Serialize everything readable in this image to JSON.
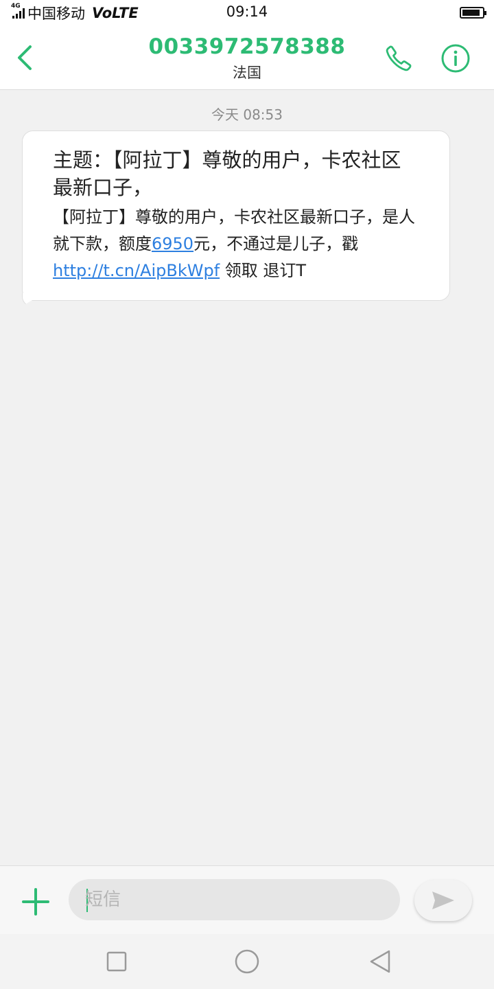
{
  "status_bar": {
    "network_type": "4G",
    "carrier": "中国移动",
    "volte": "VoLTE",
    "time": "09:14",
    "battery_level": 0.88
  },
  "header": {
    "contact_number": "0033972578388",
    "contact_location": "法国"
  },
  "conversation": {
    "timestamp": "今天 08:53",
    "message": {
      "subject": "主题：【阿拉丁】尊敬的用户，卡农社区最新口子，",
      "body_part1": "【阿拉丁】尊敬的用户，卡农社区最新口子，是人就下款，额度",
      "amount_link": "6950",
      "body_part2": "元，不通过是儿子，戳 ",
      "url_link": "http://t.cn/AipBkWpf",
      "body_part3": " 领取 退订T"
    }
  },
  "composer": {
    "placeholder": "短信"
  },
  "colors": {
    "accent": "#2dbb74",
    "link": "#2d7fe0",
    "background": "#f1f1f1"
  },
  "icons": {
    "back": "chevron-left-icon",
    "call": "phone-icon",
    "info": "info-icon",
    "add": "plus-icon",
    "send": "send-icon",
    "nav_recent": "square-icon",
    "nav_home": "circle-icon",
    "nav_back": "triangle-back-icon"
  }
}
